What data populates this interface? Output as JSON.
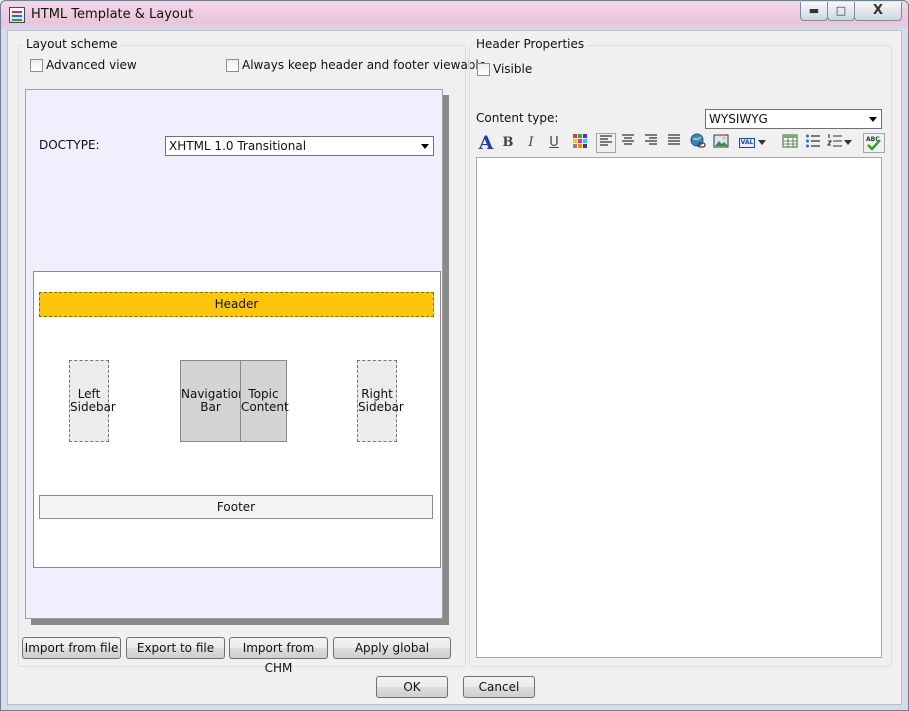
{
  "window": {
    "title": "HTML Template & Layout",
    "controls": {
      "minimize": "▬",
      "maximize": "□",
      "close": "X"
    }
  },
  "layout_scheme": {
    "title": "Layout scheme",
    "advanced_view": {
      "label": "Advanced view",
      "checked": false
    },
    "keep_viewable": {
      "label": "Always keep header and footer viewable",
      "checked": false
    },
    "doctype_label": "DOCTYPE:",
    "doctype_value": "XHTML 1.0 Transitional",
    "blocks": {
      "header": "Header",
      "left_sidebar": [
        "Left",
        "Sidebar"
      ],
      "navigation_bar": [
        "Navigation",
        "Bar"
      ],
      "topic_content": [
        "Topic",
        "Content"
      ],
      "right_sidebar": [
        "Right",
        "Sidebar"
      ],
      "footer": "Footer"
    },
    "buttons": {
      "import_file": "Import from file",
      "export_file": "Export to file",
      "import_chm": "Import from CHM",
      "apply_global": "Apply global"
    }
  },
  "header_properties": {
    "title": "Header Properties",
    "visible": {
      "label": "Visible",
      "checked": false
    },
    "content_type_label": "Content type:",
    "content_type_value": "WYSIWYG",
    "toolbar": {
      "font": "A",
      "bold": "B",
      "italic": "I",
      "underline": "U",
      "var": "VAL",
      "spell": "ABC"
    }
  },
  "dialog": {
    "ok": "OK",
    "cancel": "Cancel"
  },
  "colors": {
    "header_block": "#ffc40c",
    "scheme_background": "#efeffd"
  }
}
